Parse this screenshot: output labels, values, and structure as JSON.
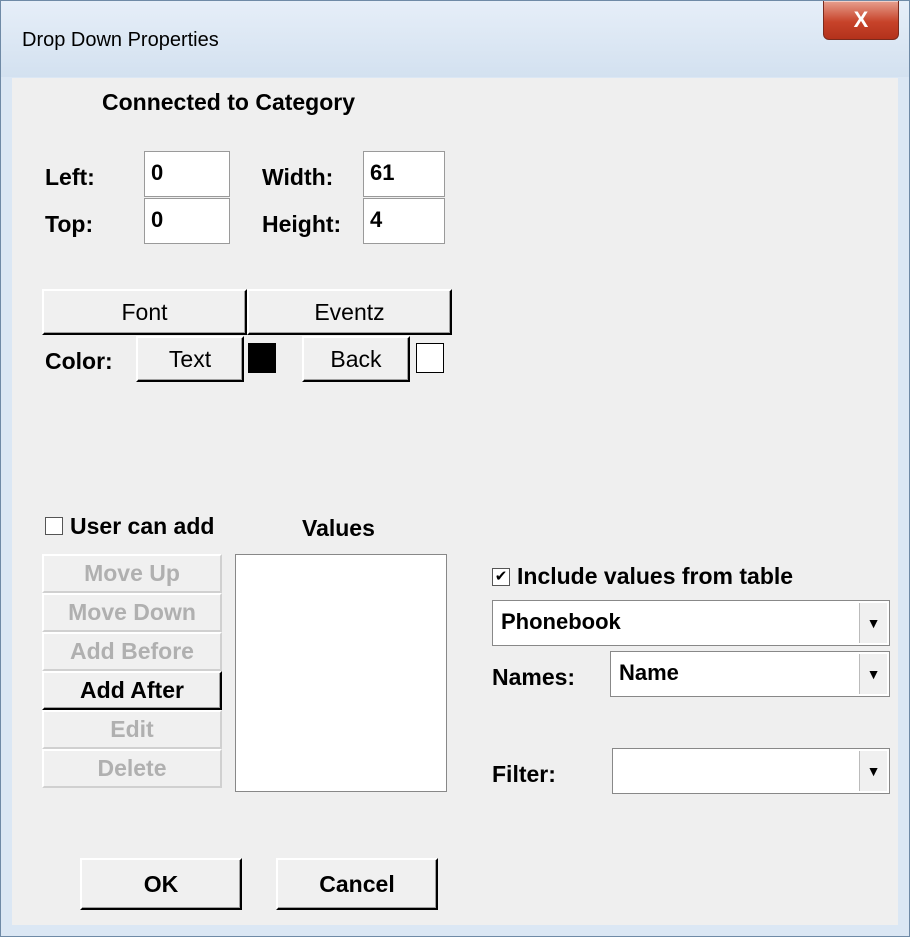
{
  "window": {
    "title": "Drop Down Properties",
    "close_label": "X"
  },
  "heading": "Connected to Category",
  "position": {
    "left_label": "Left:",
    "left_value": "0",
    "top_label": "Top:",
    "top_value": "0",
    "width_label": "Width:",
    "width_value": "61",
    "height_label": "Height:",
    "height_value": "4"
  },
  "style": {
    "font_button": "Font",
    "events_button": "Eventz",
    "color_label": "Color:",
    "text_button": "Text",
    "back_button": "Back",
    "text_color": "#000000",
    "back_color": "#ffffff"
  },
  "values_section": {
    "user_can_add_label": "User can add",
    "user_can_add_checked": false,
    "values_label": "Values",
    "buttons": {
      "move_up": "Move Up",
      "move_down": "Move Down",
      "add_before": "Add Before",
      "add_after": "Add After",
      "edit": "Edit",
      "delete": "Delete"
    }
  },
  "table_section": {
    "include_label": "Include values from table",
    "include_checked": true,
    "check_mark": "✔",
    "table_value": "Phonebook",
    "names_label": "Names:",
    "names_value": "Name",
    "filter_label": "Filter:",
    "filter_value": "",
    "dropdown_arrow": "▼"
  },
  "footer": {
    "ok_button": "OK",
    "cancel_button": "Cancel"
  }
}
